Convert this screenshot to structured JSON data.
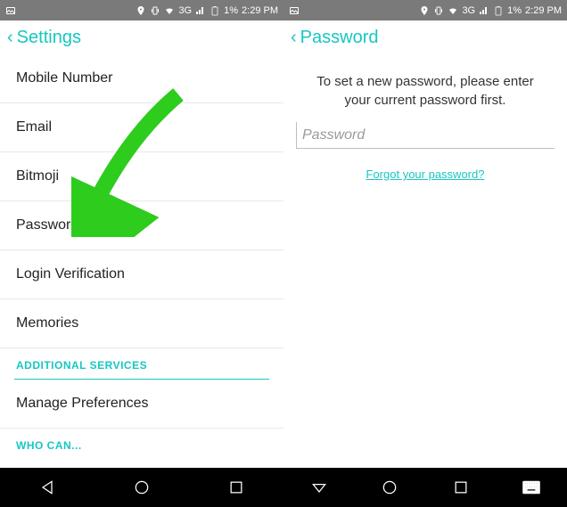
{
  "statusbar": {
    "network": "3G",
    "battery": "1%",
    "time": "2:29 PM"
  },
  "left": {
    "header_title": "Settings",
    "items": [
      "Mobile Number",
      "Email",
      "Bitmoji",
      "Password",
      "Login Verification",
      "Memories"
    ],
    "section1": "ADDITIONAL SERVICES",
    "section1_item": "Manage Preferences",
    "section2": "WHO CAN..."
  },
  "right": {
    "header_title": "Password",
    "instruction": "To set a new password, please enter your current password first.",
    "placeholder": "Password",
    "forgot": "Forgot your password?"
  },
  "colors": {
    "accent": "#17c7c1",
    "arrow": "#2dcc1d"
  }
}
